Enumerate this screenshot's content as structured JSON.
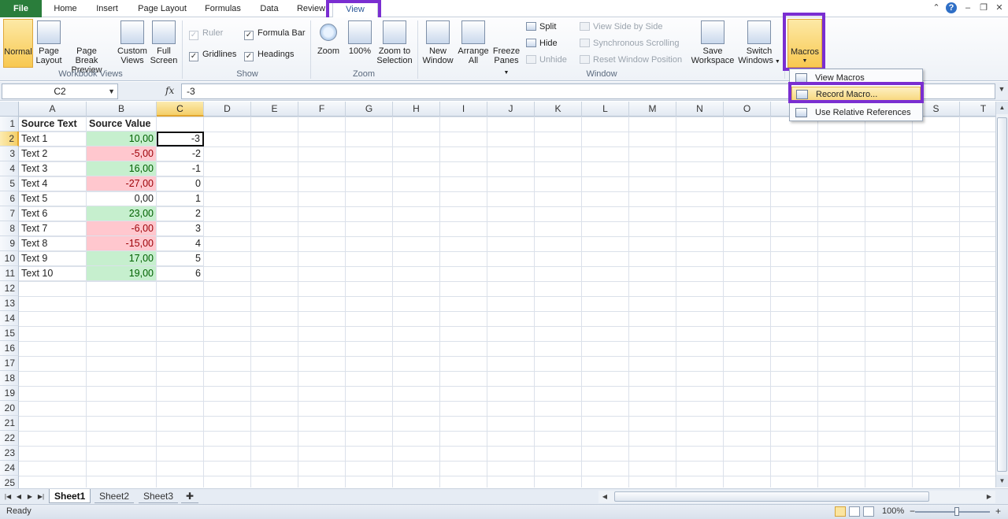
{
  "ribbon_tabs": [
    "File",
    "Home",
    "Insert",
    "Page Layout",
    "Formulas",
    "Data",
    "Review",
    "View"
  ],
  "groups": {
    "workbook_views": {
      "label": "Workbook Views",
      "normal": "Normal",
      "page_layout": [
        "Page",
        "Layout"
      ],
      "page_break": [
        "Page Break",
        "Preview"
      ],
      "custom_views": [
        "Custom",
        "Views"
      ],
      "full_screen": [
        "Full",
        "Screen"
      ]
    },
    "show": {
      "label": "Show",
      "ruler": "Ruler",
      "formula_bar": "Formula Bar",
      "gridlines": "Gridlines",
      "headings": "Headings"
    },
    "zoom": {
      "label": "Zoom",
      "zoom": "Zoom",
      "hundred": "100%",
      "zoom_to_selection": [
        "Zoom to",
        "Selection"
      ]
    },
    "window": {
      "label": "Window",
      "new_window": [
        "New",
        "Window"
      ],
      "arrange_all": [
        "Arrange",
        "All"
      ],
      "freeze_panes": [
        "Freeze",
        "Panes"
      ],
      "split": "Split",
      "hide": "Hide",
      "unhide": "Unhide",
      "view_side_by_side": "View Side by Side",
      "synchronous_scrolling": "Synchronous Scrolling",
      "reset_window_position": "Reset Window Position",
      "save_workspace": [
        "Save",
        "Workspace"
      ],
      "switch_windows": [
        "Switch",
        "Windows"
      ]
    },
    "macros": {
      "label": "Macros"
    }
  },
  "macros_menu": [
    "View Macros",
    "Record Macro...",
    "Use Relative References"
  ],
  "formula_bar": {
    "name_box": "C2",
    "fx": "fx",
    "formula": "-3"
  },
  "columns": [
    "A",
    "B",
    "C",
    "D",
    "E",
    "F",
    "G",
    "H",
    "I",
    "J",
    "K",
    "L",
    "M",
    "N",
    "O",
    "P",
    "Q",
    "R",
    "S",
    "T"
  ],
  "rows": [
    "1",
    "2",
    "3",
    "4",
    "5",
    "6",
    "7",
    "8",
    "9",
    "10",
    "11",
    "12",
    "13",
    "14",
    "15",
    "16",
    "17",
    "18",
    "19",
    "20",
    "21",
    "22",
    "23",
    "24",
    "25"
  ],
  "headers": {
    "a1": "Source Text",
    "b1": "Source Value"
  },
  "table": [
    {
      "text": "Text 1",
      "value": "10,00",
      "sign": "pos",
      "c": "-3"
    },
    {
      "text": "Text 2",
      "value": "-5,00",
      "sign": "neg",
      "c": "-2"
    },
    {
      "text": "Text 3",
      "value": "16,00",
      "sign": "pos",
      "c": "-1"
    },
    {
      "text": "Text 4",
      "value": "-27,00",
      "sign": "neg",
      "c": "0"
    },
    {
      "text": "Text 5",
      "value": "0,00",
      "sign": "none",
      "c": "1"
    },
    {
      "text": "Text 6",
      "value": "23,00",
      "sign": "pos",
      "c": "2"
    },
    {
      "text": "Text 7",
      "value": "-6,00",
      "sign": "neg",
      "c": "3"
    },
    {
      "text": "Text 8",
      "value": "-15,00",
      "sign": "neg",
      "c": "4"
    },
    {
      "text": "Text 9",
      "value": "17,00",
      "sign": "pos",
      "c": "5"
    },
    {
      "text": "Text 10",
      "value": "19,00",
      "sign": "pos",
      "c": "6"
    }
  ],
  "sheets": [
    "Sheet1",
    "Sheet2",
    "Sheet3"
  ],
  "status": {
    "ready": "Ready",
    "zoom": "100%",
    "minus": "−",
    "plus": "+"
  },
  "colors": {
    "highlight": "#7a2ed1",
    "file_tab": "#2a7d3b",
    "positive_fill": "#c6efce",
    "negative_fill": "#ffc7ce"
  }
}
